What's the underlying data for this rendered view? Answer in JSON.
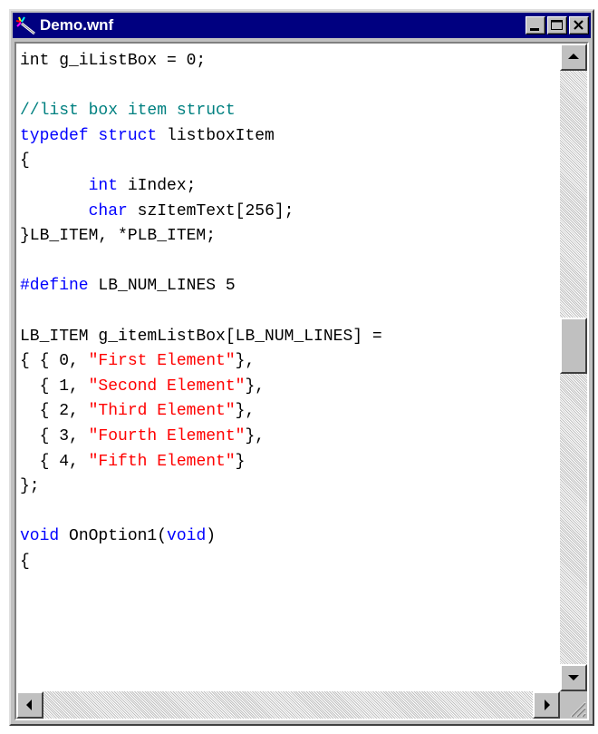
{
  "window": {
    "title": "Demo.wnf",
    "app_icon": "magic-wand-icon",
    "buttons": {
      "minimize": "minimize-icon",
      "maximize": "maximize-icon",
      "close": "close-icon"
    }
  },
  "colors": {
    "titlebar": "#000080",
    "keyword": "#0000ff",
    "comment": "#008080",
    "string": "#ff0000",
    "text": "#000000"
  },
  "scrollbar": {
    "vertical_position": 0.46,
    "horizontal_position": 0.0
  },
  "code_lines": [
    [
      {
        "t": "text",
        "v": "int g_iListBox = 0;"
      }
    ],
    [],
    [
      {
        "t": "comment",
        "v": "//list box item struct"
      }
    ],
    [
      {
        "t": "keyword",
        "v": "typedef struct"
      },
      {
        "t": "text",
        "v": " listboxItem"
      }
    ],
    [
      {
        "t": "text",
        "v": "{"
      }
    ],
    [
      {
        "t": "text",
        "v": "       "
      },
      {
        "t": "keyword",
        "v": "int"
      },
      {
        "t": "text",
        "v": " iIndex;"
      }
    ],
    [
      {
        "t": "text",
        "v": "       "
      },
      {
        "t": "keyword",
        "v": "char"
      },
      {
        "t": "text",
        "v": " szItemText[256];"
      }
    ],
    [
      {
        "t": "text",
        "v": "}LB_ITEM, *PLB_ITEM;"
      }
    ],
    [],
    [
      {
        "t": "keyword",
        "v": "#define"
      },
      {
        "t": "text",
        "v": " LB_NUM_LINES 5"
      }
    ],
    [],
    [
      {
        "t": "text",
        "v": "LB_ITEM g_itemListBox[LB_NUM_LINES] ="
      }
    ],
    [
      {
        "t": "text",
        "v": "{ { 0, "
      },
      {
        "t": "string",
        "v": "\"First Element\""
      },
      {
        "t": "text",
        "v": "},"
      }
    ],
    [
      {
        "t": "text",
        "v": "  { 1, "
      },
      {
        "t": "string",
        "v": "\"Second Element\""
      },
      {
        "t": "text",
        "v": "},"
      }
    ],
    [
      {
        "t": "text",
        "v": "  { 2, "
      },
      {
        "t": "string",
        "v": "\"Third Element\""
      },
      {
        "t": "text",
        "v": "},"
      }
    ],
    [
      {
        "t": "text",
        "v": "  { 3, "
      },
      {
        "t": "string",
        "v": "\"Fourth Element\""
      },
      {
        "t": "text",
        "v": "},"
      }
    ],
    [
      {
        "t": "text",
        "v": "  { 4, "
      },
      {
        "t": "string",
        "v": "\"Fifth Element\""
      },
      {
        "t": "text",
        "v": "}"
      }
    ],
    [
      {
        "t": "text",
        "v": "};"
      }
    ],
    [],
    [
      {
        "t": "keyword",
        "v": "void"
      },
      {
        "t": "text",
        "v": " OnOption1("
      },
      {
        "t": "keyword",
        "v": "void"
      },
      {
        "t": "text",
        "v": ")"
      }
    ],
    [
      {
        "t": "text",
        "v": "{"
      }
    ]
  ]
}
